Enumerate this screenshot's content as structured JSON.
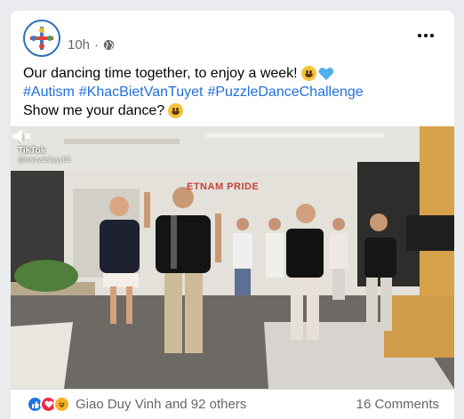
{
  "post": {
    "page_name": "",
    "timestamp": "10h",
    "separator": "·",
    "privacy_icon": "globe-icon",
    "more_icon": "more-options-icon",
    "text_line1": "Our dancing time together, to enjoy a week!",
    "hashtags": [
      "#Autism",
      "#KhacBietVanTuyet",
      "#PuzzleDanceChallenge"
    ],
    "text_line3": "Show me your dance?"
  },
  "video": {
    "watermark_brand": "TikTok",
    "watermark_handle": "@harrydailyyy65",
    "wall_sign": "ETNAM PRIDE",
    "mute_icon": "mute-icon"
  },
  "footer": {
    "reaction_icons": [
      "like-icon",
      "love-icon",
      "haha-icon"
    ],
    "reaction_summary": "Giao Duy Vinh and 92 others",
    "comments_count": "16 Comments"
  },
  "colors": {
    "hashtag": "#216fdb",
    "secondary_text": "#65676b",
    "like": "#1b74e4",
    "love": "#f0284a",
    "haha": "#f7b125",
    "avatar_ring": "#2d6fb8"
  }
}
